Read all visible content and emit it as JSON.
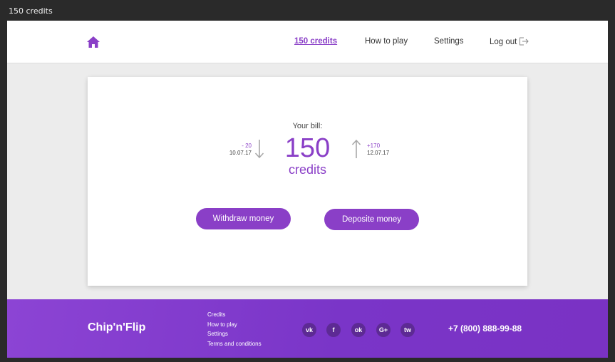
{
  "window": {
    "title": "150 credits"
  },
  "header": {
    "nav": [
      {
        "label": "150 credits",
        "active": true
      },
      {
        "label": "How to play",
        "active": false
      },
      {
        "label": "Settings",
        "active": false
      },
      {
        "label": "Log out",
        "active": false
      }
    ]
  },
  "bill": {
    "label": "Your bill:",
    "amount": "150",
    "unit": "credits",
    "last_debit": {
      "delta": "- 20",
      "date": "10.07.17"
    },
    "last_credit": {
      "delta": "+170",
      "date": "12.07.17"
    }
  },
  "actions": {
    "withdraw_label": "Withdraw money",
    "deposit_label": "Deposite money"
  },
  "footer": {
    "brand": "Chip'n'Flip",
    "links": [
      "Credits",
      "How to play",
      "Settings",
      "Terms and conditions"
    ],
    "social": [
      {
        "name": "vk-icon",
        "glyph": "vk"
      },
      {
        "name": "facebook-icon",
        "glyph": "f"
      },
      {
        "name": "odnoklassniki-icon",
        "glyph": "ok"
      },
      {
        "name": "google-plus-icon",
        "glyph": "G+"
      },
      {
        "name": "twitter-icon",
        "glyph": "tw"
      }
    ],
    "phone": "+7 (800) 888-99-88"
  },
  "colors": {
    "accent": "#8a3fc7",
    "footer_start": "#8c44d4",
    "footer_end": "#7a32c4",
    "page_bg": "#ececec",
    "muted_arrow": "#a8a8a8"
  }
}
